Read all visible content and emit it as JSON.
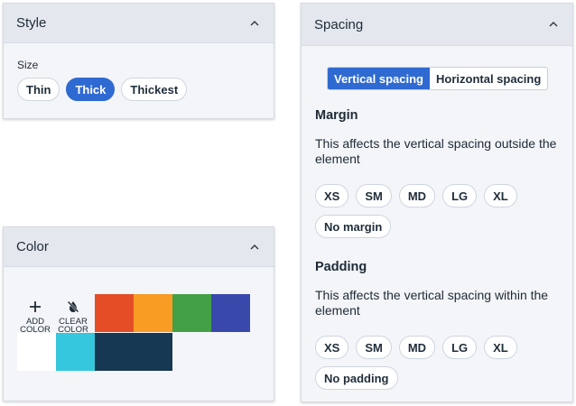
{
  "style_panel": {
    "title": "Style",
    "size_label": "Size",
    "sizes": [
      {
        "label": "Thin",
        "active": false
      },
      {
        "label": "Thick",
        "active": true
      },
      {
        "label": "Thickest",
        "active": false
      }
    ]
  },
  "color_panel": {
    "title": "Color",
    "add_color": {
      "line1": "ADD",
      "line2": "COLOR",
      "icon": "plus-icon"
    },
    "clear_color": {
      "line1": "CLEAR",
      "line2": "COLOR",
      "icon": "no-fill-icon"
    },
    "swatches": [
      "#e44d26",
      "#f89c24",
      "#43a047",
      "#3949ab",
      "#ffffff",
      "#35c7dd",
      "#163852",
      "#163852"
    ]
  },
  "spacing_panel": {
    "title": "Spacing",
    "tabs": [
      {
        "label": "Vertical spacing",
        "active": true
      },
      {
        "label": "Horizontal spacing",
        "active": false
      }
    ],
    "margin": {
      "title": "Margin",
      "description": "This affects the vertical spacing outside the element",
      "options": [
        "XS",
        "SM",
        "MD",
        "LG",
        "XL"
      ],
      "none_label": "No margin"
    },
    "padding": {
      "title": "Padding",
      "description": "This affects the vertical spacing within the element",
      "options": [
        "XS",
        "SM",
        "MD",
        "LG",
        "XL"
      ],
      "none_label": "No padding"
    }
  },
  "colors": {
    "accent": "#2f6ad2",
    "panel_bg": "#f3f5f8",
    "header_bg": "#e4e8ee"
  }
}
